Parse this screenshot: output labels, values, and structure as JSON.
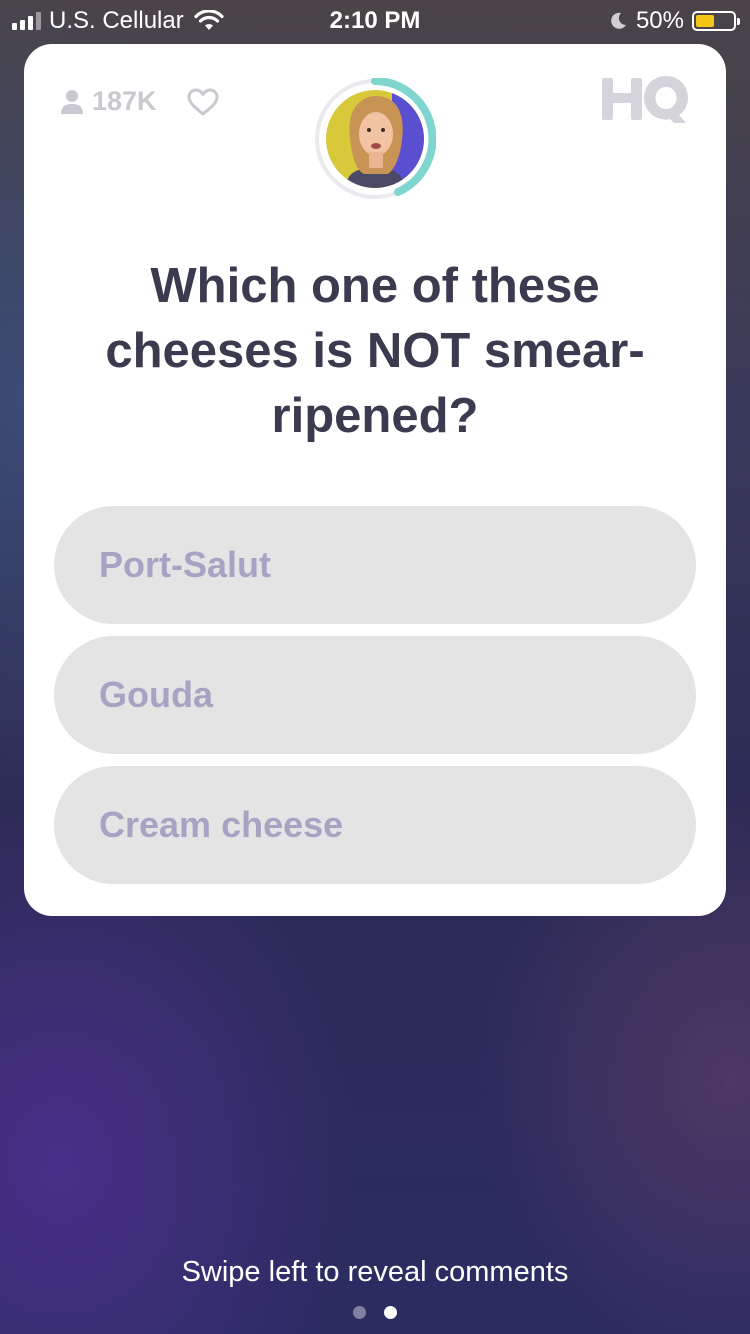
{
  "status_bar": {
    "carrier": "U.S. Cellular",
    "time": "2:10 PM",
    "battery_percent": "50%",
    "battery_level": 0.5,
    "icons": [
      "signal-icon",
      "wifi-icon",
      "moon-icon",
      "battery-icon"
    ]
  },
  "game": {
    "viewer_count": "187K",
    "logo": "HQ",
    "icons": [
      "person-icon",
      "heart-icon",
      "hq-logo-icon"
    ],
    "timer_ring_color": "#7ed6cf",
    "question": "Which one of these cheeses is NOT smear-ripened?",
    "answers": [
      {
        "label": "Port-Salut"
      },
      {
        "label": "Gouda"
      },
      {
        "label": "Cream cheese"
      }
    ]
  },
  "footer": {
    "swipe_hint": "Swipe left to reveal comments",
    "pages_total": 2,
    "active_page": 2
  },
  "colors": {
    "card_background": "#ffffff",
    "answer_background": "#e4e4e4",
    "answer_text": "#a7a3c2",
    "question_text": "#3b3b4f",
    "battery_fill": "#f5c518"
  }
}
